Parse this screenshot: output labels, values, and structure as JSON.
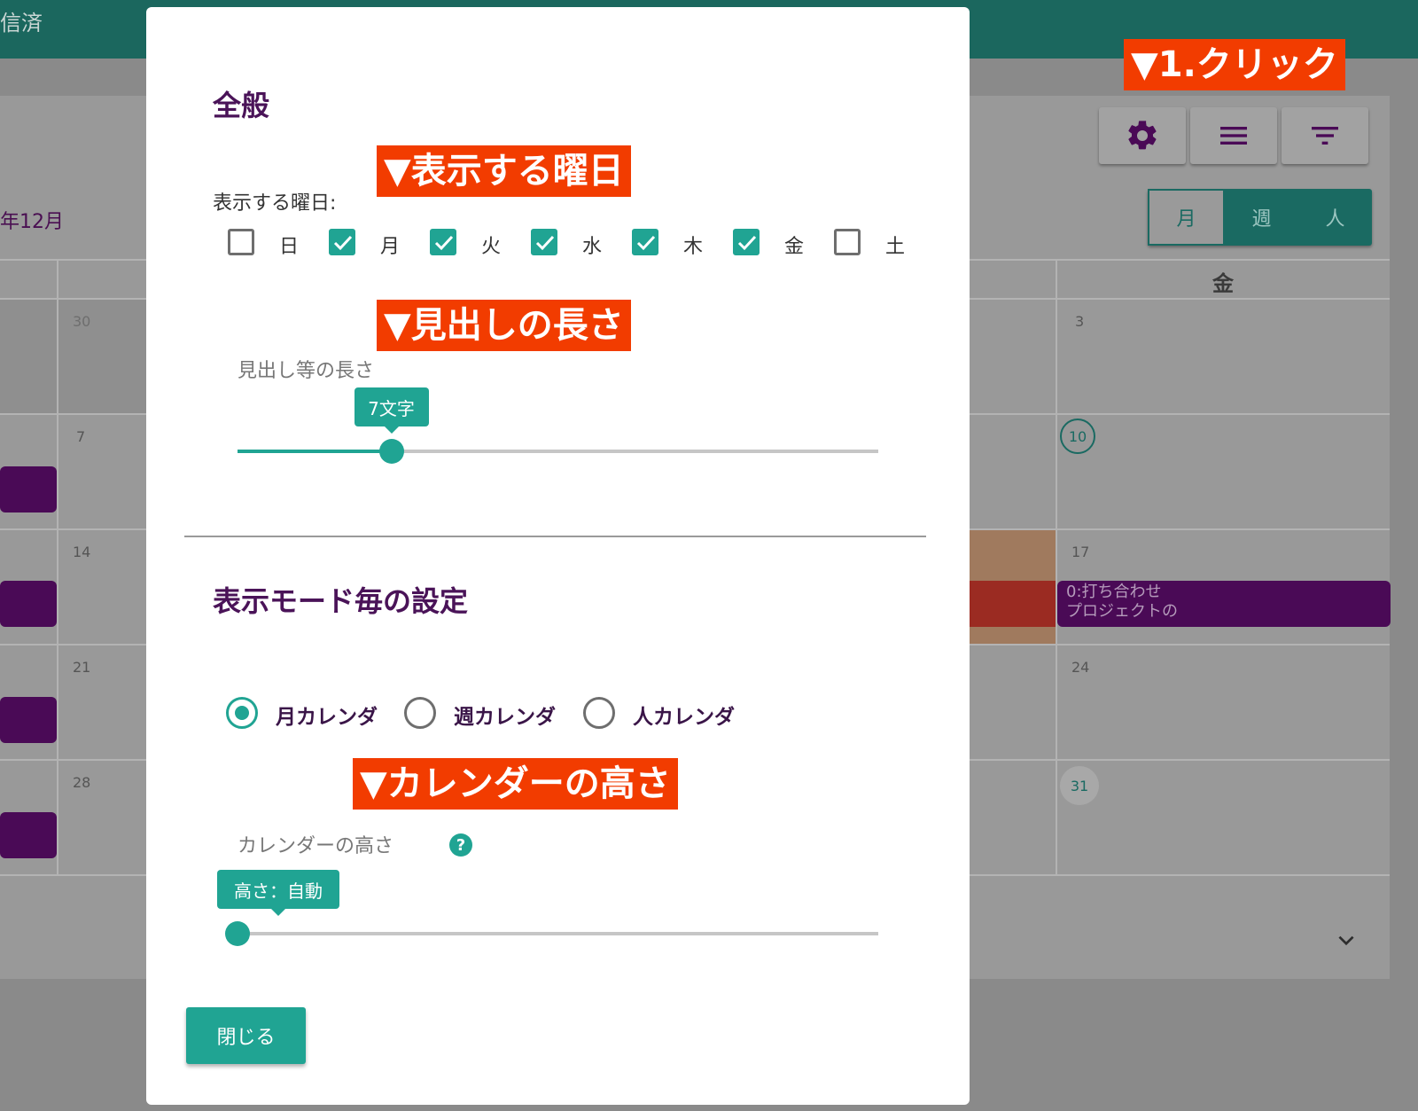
{
  "app": {
    "topbar_text": "信済",
    "month_title": "年12月"
  },
  "toolbar": {
    "settings_icon": "gear-icon",
    "menu_icon": "menu-icon",
    "filter_icon": "filter-icon"
  },
  "view_toggle": {
    "month": "月",
    "week": "週",
    "person": "人"
  },
  "calendar": {
    "weekday_header": "金",
    "cells": [
      "30",
      "7",
      "14",
      "21",
      "28",
      "3",
      "10",
      "17",
      "24",
      "31"
    ],
    "event_text_line1": "0:打ち合わせ",
    "event_text_line2": "プロジェクトの"
  },
  "annotations": {
    "click": "▼1.クリック",
    "weekdays": "▼表示する曜日",
    "heading_length": "▼見出しの長さ",
    "calendar_height": "▼カレンダーの高さ"
  },
  "dialog": {
    "general_title": "全般",
    "weekdays_label": "表示する曜日:",
    "weekdays": [
      {
        "label": "日",
        "checked": false
      },
      {
        "label": "月",
        "checked": true
      },
      {
        "label": "火",
        "checked": true
      },
      {
        "label": "水",
        "checked": true
      },
      {
        "label": "木",
        "checked": true
      },
      {
        "label": "金",
        "checked": true
      },
      {
        "label": "土",
        "checked": false
      }
    ],
    "heading_length_label": "見出し等の長さ",
    "heading_length_value": "7文字",
    "heading_length_fraction": 0.24,
    "mode_title": "表示モード毎の設定",
    "modes": [
      {
        "label": "月カレンダ",
        "selected": true
      },
      {
        "label": "週カレンダ",
        "selected": false
      },
      {
        "label": "人カレンダ",
        "selected": false
      }
    ],
    "calendar_height_label": "カレンダーの高さ",
    "help_icon": "?",
    "calendar_height_value": "高さ：自動",
    "calendar_height_fraction": 0,
    "close_label": "閉じる"
  },
  "colors": {
    "accent": "#20a493",
    "title": "#4a1358",
    "annotation": "#f23c00",
    "topbar": "#1b675e"
  },
  "scroll_icon": "chevron-down-icon"
}
